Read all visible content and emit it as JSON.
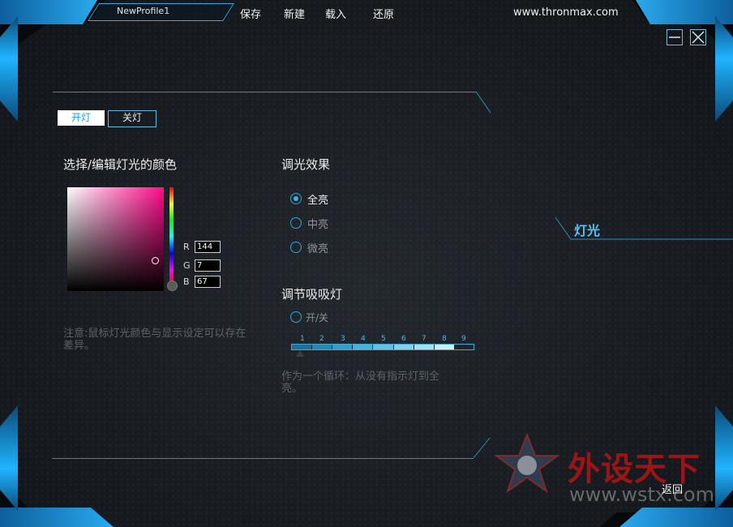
{
  "topbar": {
    "profile_name": "NewProfile1",
    "menu": [
      "保存",
      "新建",
      "载入",
      "还原"
    ],
    "site": "www.thronmax.com"
  },
  "light_toggle": {
    "on_label": "开灯",
    "off_label": "关灯",
    "selected": "开灯"
  },
  "color_section": {
    "title": "选择/编辑灯光的颜色",
    "r_label": "R",
    "g_label": "G",
    "b_label": "B",
    "r": "144",
    "g": "7",
    "b": "67",
    "note": "注意:鼠标灯光颜色与显示设定可以存在差异。"
  },
  "dimming": {
    "title": "调光效果",
    "options": [
      "全亮",
      "中亮",
      "微亮"
    ],
    "selected": "全亮"
  },
  "breathing": {
    "title": "调节吸吸灯",
    "toggle_label": "开/关",
    "ticks": [
      "1",
      "2",
      "3",
      "4",
      "5",
      "6",
      "7",
      "8",
      "9"
    ],
    "note": "作为一个循环：从没有指示灯到全亮。"
  },
  "side_tab": {
    "label": "灯光"
  },
  "footer": {
    "back_label": "返回"
  },
  "watermark": {
    "text": "外设天下",
    "url": "www.wstx.com"
  },
  "colors": {
    "accent": "#2aa9ee",
    "selected_color": "#900743"
  }
}
